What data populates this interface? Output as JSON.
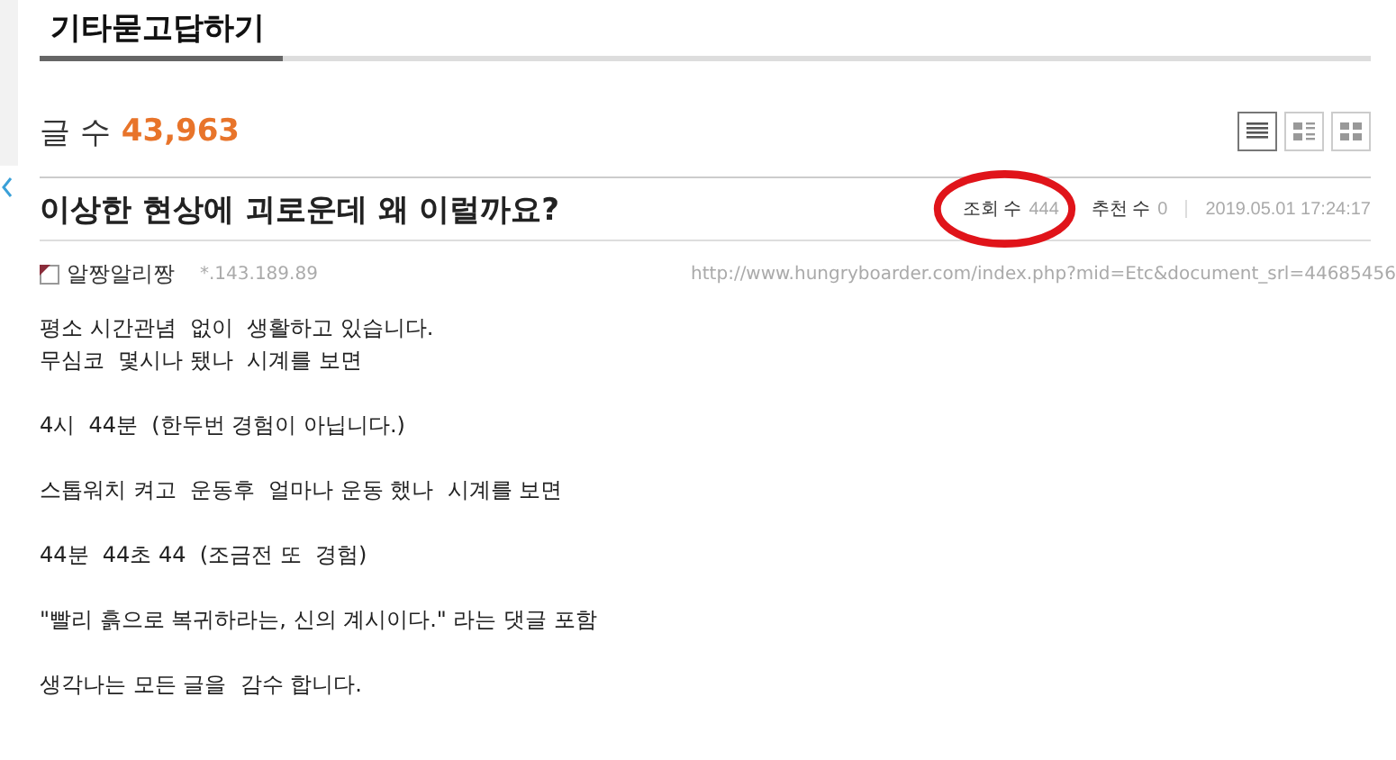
{
  "board": {
    "title": "기타묻고답하기",
    "count_label": "글 수",
    "count": "43,963",
    "view_modes": [
      {
        "kind": "list",
        "selected": true
      },
      {
        "kind": "webzine",
        "selected": false
      },
      {
        "kind": "gallery",
        "selected": false
      }
    ]
  },
  "post": {
    "title": "이상한 현상에 괴로운데 왜 이럴까요?",
    "views_label": "조회 수",
    "views": "444",
    "votes_label": "추천 수",
    "votes": "0",
    "date": "2019.05.01 17:24:17",
    "author": "알짱알리짱",
    "ip": "*.143.189.89",
    "url": "http://www.hungryboarder.com/index.php?mid=Etc&document_srl=44685456",
    "body": [
      "평소 시간관념  없이  생활하고 있습니다.\n무심코  몇시나 됐나  시계를 보면",
      "4시  44분  (한두번 경험이 아닙니다.)",
      "스톱워치 켜고  운동후  얼마나 운동 했나  시계를 보면",
      "44분  44초 44  (조금전 또  경험)",
      "\"빨리 흙으로 복귀하라는, 신의 계시이다.\" 라는 댓글 포함",
      "생각나는 모든 글을  감수 합니다."
    ]
  }
}
